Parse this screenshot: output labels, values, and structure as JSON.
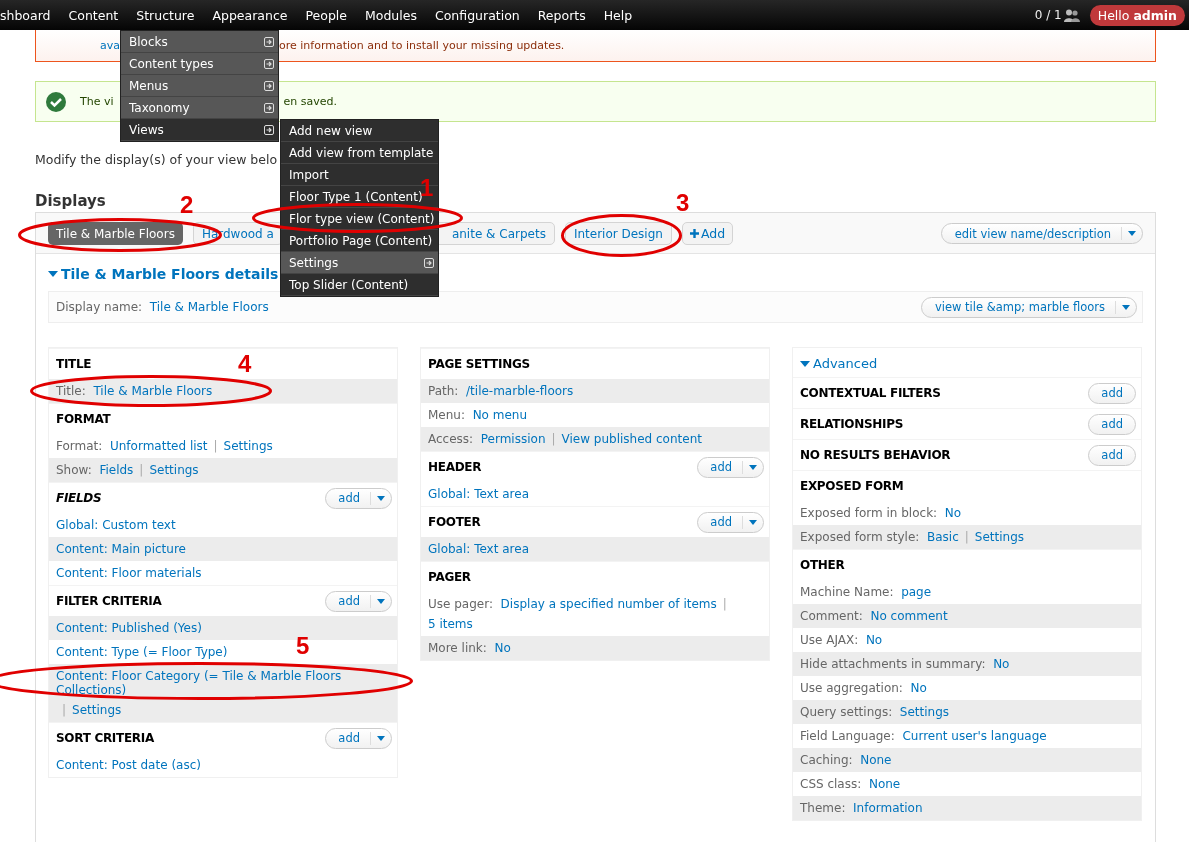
{
  "toolbar": {
    "items": [
      "shboard",
      "Content",
      "Structure",
      "Appearance",
      "People",
      "Modules",
      "Configuration",
      "Reports",
      "Help"
    ],
    "user_count": "0 / 1",
    "greeting": "Hello **admin**"
  },
  "messages": [
    {
      "kind": "error",
      "visible_start": "ava",
      "visible_end": "ore information and to install your missing updates."
    },
    {
      "kind": "status",
      "visible_start": "The vi",
      "visible_end": "en saved."
    }
  ],
  "intro": "Modify the display(s) of your view belo",
  "displays_heading": "Displays",
  "display_tabs": [
    {
      "label": "Tile & Marble Floors",
      "selected": true
    },
    {
      "label": "Hardwood a",
      "selected": false
    },
    {
      "label": "anite & Carpets",
      "selected": false
    },
    {
      "label": "Interior Design",
      "selected": false
    }
  ],
  "add_display_button": "Add",
  "edit_view_button": "edit view name/description",
  "details": {
    "title": "Tile & Marble Floors details",
    "expanded": true
  },
  "display_name": {
    "label": "Display name:",
    "value": "Tile & Marble Floors",
    "button": "view tile &amp; marble floors"
  },
  "columns": [
    {
      "sections": [
        {
          "title": "TITLE",
          "italic": false,
          "rows": [
            {
              "label": "Title:",
              "links": [
                "Tile & Marble Floors"
              ],
              "striped": true
            }
          ]
        },
        {
          "title": "FORMAT",
          "italic": false,
          "rows": [
            {
              "label": "Format:",
              "links": [
                "Unformatted list",
                "Settings"
              ],
              "separator": "|",
              "striped": false
            },
            {
              "label": "Show:",
              "links": [
                "Fields",
                "Settings"
              ],
              "separator": "|",
              "striped": true
            }
          ]
        },
        {
          "title": "FIELDS",
          "italic": true,
          "add_button": {
            "label": "add",
            "dropdown": true
          },
          "rows": [
            {
              "links": [
                "Global: Custom text"
              ],
              "striped": false
            },
            {
              "links": [
                "Content: Main picture"
              ],
              "striped": true
            },
            {
              "links": [
                "Content: Floor materials"
              ],
              "striped": false
            }
          ]
        },
        {
          "title": "FILTER CRITERIA",
          "italic": false,
          "add_button": {
            "label": "add",
            "dropdown": true
          },
          "rows": [
            {
              "links": [
                "Content: Published (Yes)"
              ],
              "striped": true
            },
            {
              "links": [
                "Content: Type (= Floor Type)"
              ],
              "striped": false
            },
            {
              "links": [
                "Content: Floor Category (= Tile & Marble Floors Collections)",
                "Settings"
              ],
              "separator": "|",
              "striped": true
            }
          ]
        },
        {
          "title": "SORT CRITERIA",
          "italic": false,
          "add_button": {
            "label": "add",
            "dropdown": true
          },
          "rows": [
            {
              "links": [
                "Content: Post date (asc)"
              ],
              "striped": false
            }
          ]
        }
      ]
    },
    {
      "sections": [
        {
          "title": "PAGE SETTINGS",
          "italic": false,
          "rows": [
            {
              "label": "Path:",
              "links": [
                "/tile-marble-floors"
              ],
              "striped": true
            },
            {
              "label": "Menu:",
              "links": [
                "No menu"
              ],
              "striped": false
            },
            {
              "label": "Access:",
              "links": [
                "Permission",
                "View published content"
              ],
              "separator": "|",
              "striped": true
            }
          ]
        },
        {
          "title": "HEADER",
          "italic": false,
          "add_button": {
            "label": "add",
            "dropdown": true
          },
          "rows": [
            {
              "links": [
                "Global: Text area"
              ],
              "striped": false
            }
          ]
        },
        {
          "title": "FOOTER",
          "italic": false,
          "add_button": {
            "label": "add",
            "dropdown": true
          },
          "rows": [
            {
              "links": [
                "Global: Text area"
              ],
              "striped": true
            }
          ]
        },
        {
          "title": "PAGER",
          "italic": false,
          "rows": [
            {
              "label": "Use pager:",
              "links": [
                "Display a specified number of items",
                "5 items"
              ],
              "separator": "|",
              "striped": false
            },
            {
              "label": "More link:",
              "links": [
                "No"
              ],
              "striped": true
            }
          ]
        }
      ]
    },
    {
      "advanced": {
        "label": "Advanced",
        "expanded": true
      },
      "sections": [
        {
          "title": "CONTEXTUAL FILTERS",
          "italic": false,
          "add_button": {
            "label": "add",
            "dropdown": false
          }
        },
        {
          "title": "RELATIONSHIPS",
          "italic": false,
          "add_button": {
            "label": "add",
            "dropdown": false
          }
        },
        {
          "title": "NO RESULTS BEHAVIOR",
          "italic": false,
          "add_button": {
            "label": "add",
            "dropdown": false
          }
        },
        {
          "title": "EXPOSED FORM",
          "italic": false,
          "rows": [
            {
              "label": "Exposed form in block:",
              "links": [
                "No"
              ],
              "striped": false
            },
            {
              "label": "Exposed form style:",
              "links": [
                "Basic",
                "Settings"
              ],
              "separator": "|",
              "striped": true
            }
          ]
        },
        {
          "title": "OTHER",
          "italic": false,
          "rows": [
            {
              "label": "Machine Name:",
              "links": [
                "page"
              ],
              "striped": false
            },
            {
              "label": "Comment:",
              "links": [
                "No comment"
              ],
              "striped": true
            },
            {
              "label": "Use AJAX:",
              "links": [
                "No"
              ],
              "striped": false
            },
            {
              "label": "Hide attachments in summary:",
              "links": [
                "No"
              ],
              "striped": true
            },
            {
              "label": "Use aggregation:",
              "links": [
                "No"
              ],
              "striped": false
            },
            {
              "label": "Query settings:",
              "links": [
                "Settings"
              ],
              "striped": true
            },
            {
              "label": "Field Language:",
              "links": [
                "Current user's language"
              ],
              "striped": false
            },
            {
              "label": "Caching:",
              "links": [
                "None"
              ],
              "striped": true
            },
            {
              "label": "CSS class:",
              "links": [
                "None"
              ],
              "striped": false
            },
            {
              "label": "Theme:",
              "links": [
                "Information"
              ],
              "striped": true
            }
          ]
        }
      ]
    }
  ],
  "structure_menu": [
    {
      "label": "Blocks",
      "has_submenu": true,
      "expanded": false
    },
    {
      "label": "Content types",
      "has_submenu": true,
      "expanded": false
    },
    {
      "label": "Menus",
      "has_submenu": true,
      "expanded": false
    },
    {
      "label": "Taxonomy",
      "has_submenu": true,
      "expanded": false
    },
    {
      "label": "Views",
      "has_submenu": true,
      "expanded": true
    }
  ],
  "views_submenu": [
    {
      "label": "Add new view",
      "has_submenu": false
    },
    {
      "label": "Add view from template",
      "has_submenu": false
    },
    {
      "label": "Import",
      "has_submenu": false
    },
    {
      "label": "Floor Type 1 (Content)",
      "has_submenu": false
    },
    {
      "label": "Flor type view (Content)",
      "has_submenu": false
    },
    {
      "label": "Portfolio Page (Content)",
      "has_submenu": false
    },
    {
      "label": "Settings",
      "has_submenu": true
    },
    {
      "label": "Top Slider (Content)",
      "has_submenu": false
    }
  ],
  "annotations": [
    {
      "number": "1"
    },
    {
      "number": "2"
    },
    {
      "number": "3"
    },
    {
      "number": "4"
    },
    {
      "number": "5"
    }
  ]
}
